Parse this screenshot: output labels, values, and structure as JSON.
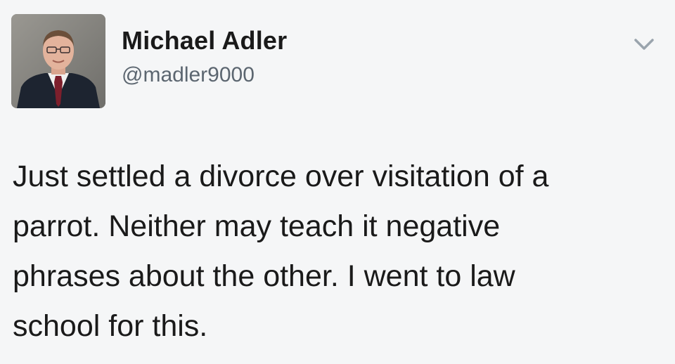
{
  "tweet": {
    "author": {
      "display_name": "Michael Adler",
      "handle": "@madler9000",
      "avatar_icon": "profile-photo-man-in-suit"
    },
    "menu_icon": "chevron-down-icon",
    "text_lines": [
      "Just settled a divorce over visitation of a",
      "parrot. Neither may teach it negative",
      "phrases about the other. I went to law",
      "school for this."
    ]
  },
  "colors": {
    "background": "#f5f6f7",
    "text_primary": "#1a1a1a",
    "text_secondary": "#5c6670",
    "chevron": "#9aa4ad"
  }
}
